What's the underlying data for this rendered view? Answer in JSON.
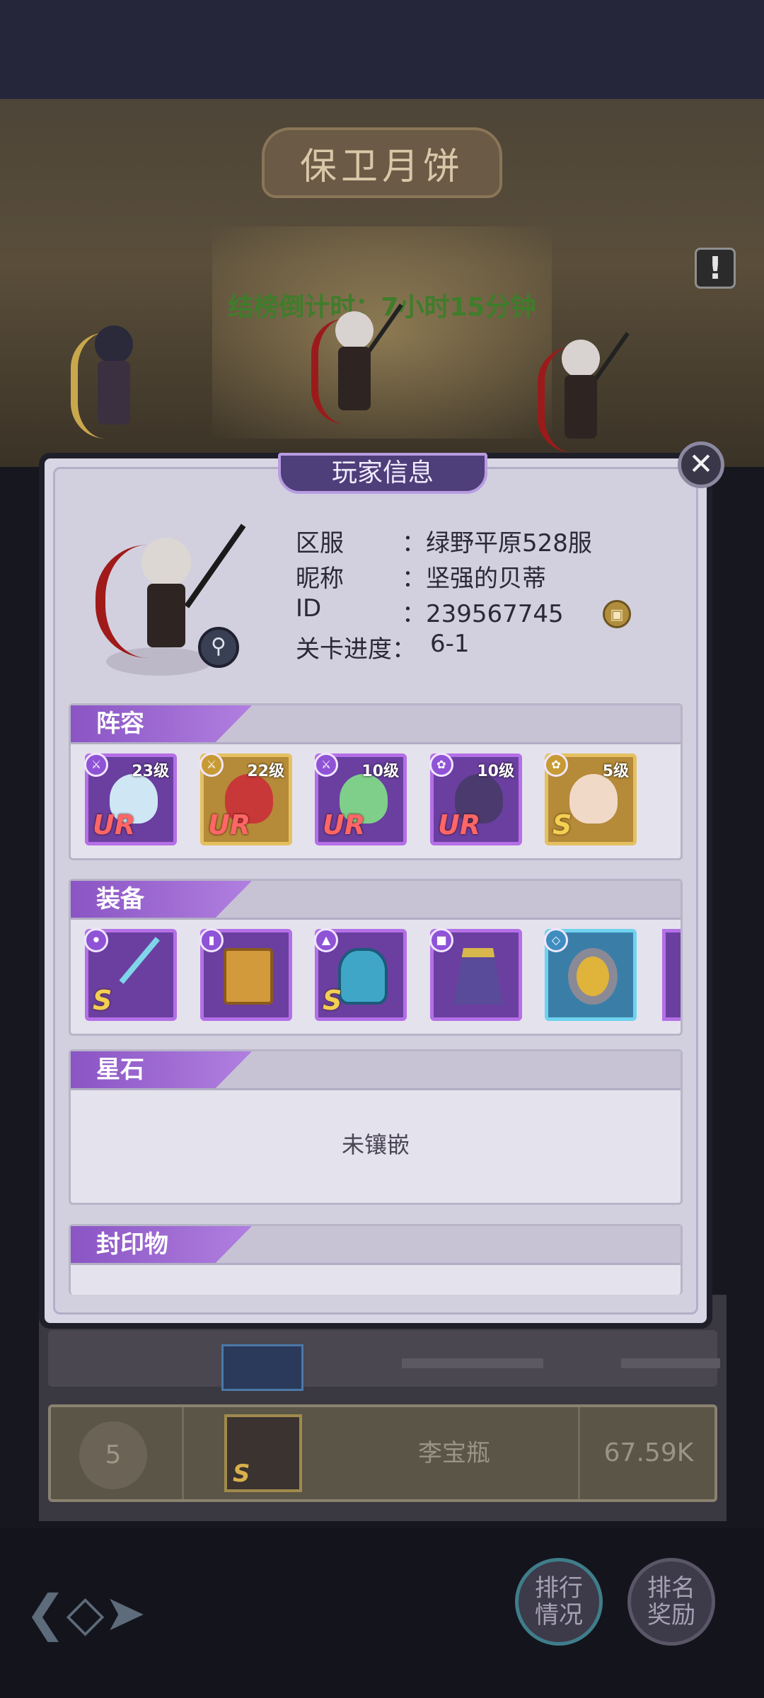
{
  "event": {
    "title": "保卫月饼",
    "countdown": "结榜倒计时：7小时15分钟"
  },
  "modal": {
    "title": "玩家信息",
    "close_label": "✕",
    "info": [
      {
        "label": "区服",
        "value": "：绿野平原528服"
      },
      {
        "label": "昵称",
        "value": "：坚强的贝蒂"
      },
      {
        "label": "ID",
        "value": "：239567745"
      },
      {
        "label": "关卡进度：",
        "value": "6-1"
      }
    ],
    "sections": {
      "lineup": "阵容",
      "equipment": "装备",
      "star_stones": "星石",
      "seals": "封印物"
    },
    "lineup": [
      {
        "level": "23级",
        "rarity": "UR",
        "frame": "purple",
        "icon": "dagger-icon"
      },
      {
        "level": "22级",
        "rarity": "UR",
        "frame": "gold",
        "icon": "sword-icon"
      },
      {
        "level": "10级",
        "rarity": "UR",
        "frame": "purple",
        "icon": "dagger-icon"
      },
      {
        "level": "10级",
        "rarity": "UR",
        "frame": "purple",
        "icon": "swirl-icon"
      },
      {
        "level": "5级",
        "rarity": "S",
        "frame": "gold",
        "icon": "swirl-icon"
      }
    ],
    "equipment": [
      {
        "rarity": "S",
        "frame": "purple",
        "icon": "trident-icon"
      },
      {
        "rarity": "",
        "frame": "purple",
        "icon": "book-icon"
      },
      {
        "rarity": "S",
        "frame": "purple",
        "icon": "helmet-icon"
      },
      {
        "rarity": "",
        "frame": "purple",
        "icon": "skirt-icon"
      },
      {
        "rarity": "",
        "frame": "blue",
        "icon": "ring-icon"
      }
    ],
    "gems_empty": "未镶嵌"
  },
  "ranking": {
    "row": {
      "rank": "5",
      "avatar_rarity": "S",
      "name": "李宝瓶",
      "score": "67.59K"
    }
  },
  "buttons": {
    "rank_status": "排行\n情况",
    "rank_reward": "排名\n奖励"
  },
  "colors": {
    "accent_purple": "#8a55c4",
    "countdown_green": "#3f7d2b",
    "ur_red": "#ff6666",
    "s_gold": "#f3cf52"
  }
}
